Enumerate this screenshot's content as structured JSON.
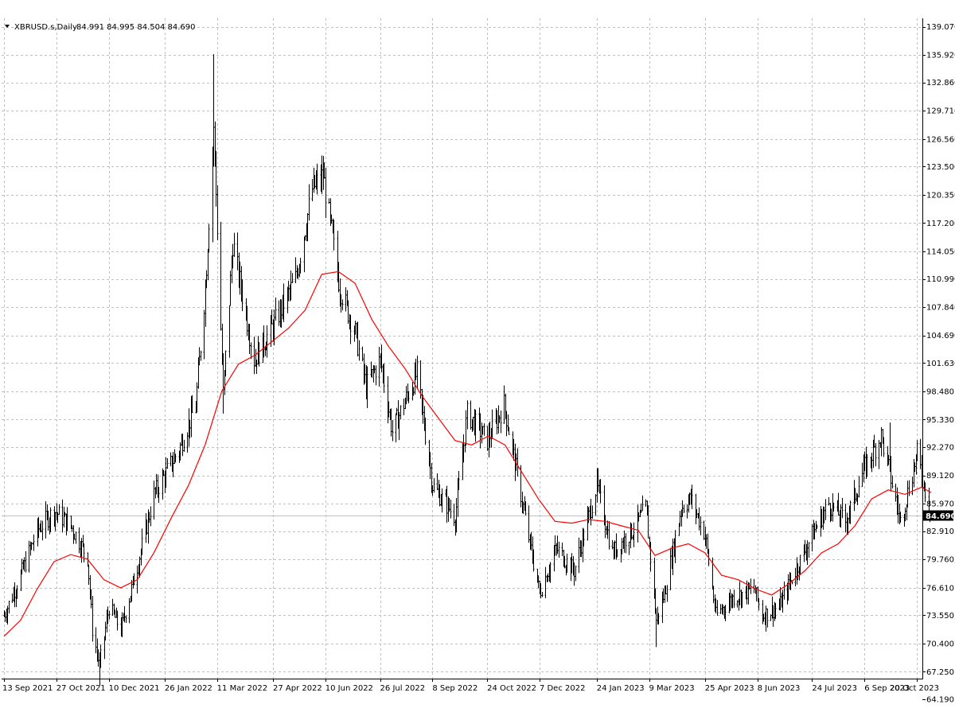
{
  "header": {
    "symbol_label": "XBRUSD.s,Daily",
    "ohlc_label": "84.991 84.995 84.504 84.690",
    "dropdown_icon": "triangle-down-icon"
  },
  "price_tag": {
    "label": "84.690",
    "value": 84.69,
    "background": "#000000",
    "line_color": "#c0c0c0"
  },
  "colors": {
    "bars": "#000000",
    "moving_average": "#ff0000",
    "grid": "#c0c0c0",
    "axis": "#000000",
    "background": "#ffffff"
  },
  "chart_data": {
    "type": "line",
    "title": "",
    "xlabel": "",
    "ylabel": "",
    "grid": true,
    "legend": "none",
    "ylim": [
      64.19,
      139.07
    ],
    "xlim": [
      "2021-09-13",
      "2023-11-01"
    ],
    "y_ticks": [
      139.07,
      135.92,
      132.86,
      129.71,
      126.56,
      123.5,
      120.35,
      117.2,
      114.05,
      110.99,
      107.84,
      104.69,
      101.63,
      98.48,
      95.33,
      92.27,
      89.12,
      85.97,
      82.91,
      79.76,
      76.61,
      73.55,
      70.4,
      67.25,
      64.19
    ],
    "y_tick_labels": [
      "139.070",
      "135.920",
      "132.860",
      "129.710",
      "126.560",
      "123.500",
      "120.350",
      "117.200",
      "114.050",
      "110.990",
      "107.840",
      "104.690",
      "101.630",
      "98.480",
      "95.330",
      "92.270",
      "89.120",
      "85.970",
      "82.910",
      "79.760",
      "76.610",
      "73.550",
      "70.400",
      "67.250",
      "64.190"
    ],
    "x_ticks": [
      "2021-09-13",
      "2021-10-27",
      "2021-12-10",
      "2022-01-26",
      "2022-03-11",
      "2022-04-27",
      "2022-06-10",
      "2022-07-26",
      "2022-09-08",
      "2022-10-24",
      "2022-12-07",
      "2023-01-24",
      "2023-03-09",
      "2023-04-25",
      "2023-06-08",
      "2023-07-24",
      "2023-09-06",
      "2023-10-20"
    ],
    "x_tick_labels": [
      "13 Sep 2021",
      "27 Oct 2021",
      "10 Dec 2021",
      "26 Jan 2022",
      "11 Mar 2022",
      "27 Apr 2022",
      "10 Jun 2022",
      "26 Jul 2022",
      "8 Sep 2022",
      "24 Oct 2022",
      "7 Dec 2022",
      "24 Jan 2023",
      "9 Mar 2023",
      "25 Apr 2023",
      "8 Jun 2023",
      "24 Jul 2023",
      "6 Sep 2023",
      "20 Oct 2023"
    ],
    "series": [
      {
        "type": "ohlc",
        "close_path": [
          [
            "2021-09-13",
            73.5
          ],
          [
            "2021-09-27",
            78.0
          ],
          [
            "2021-10-11",
            83.0
          ],
          [
            "2021-10-25",
            85.2
          ],
          [
            "2021-11-08",
            83.5
          ],
          [
            "2021-11-22",
            80.0
          ],
          [
            "2021-11-26",
            72.0
          ],
          [
            "2021-12-02",
            68.0
          ],
          [
            "2021-12-10",
            74.5
          ],
          [
            "2021-12-20",
            72.0
          ],
          [
            "2022-01-03",
            79.0
          ],
          [
            "2022-01-17",
            87.0
          ],
          [
            "2022-02-07",
            92.0
          ],
          [
            "2022-02-21",
            97.0
          ],
          [
            "2022-03-01",
            110.0
          ],
          [
            "2022-03-08",
            128.0
          ],
          [
            "2022-03-16",
            98.0
          ],
          [
            "2022-03-24",
            115.0
          ],
          [
            "2022-04-11",
            102.0
          ],
          [
            "2022-04-28",
            106.0
          ],
          [
            "2022-05-16",
            111.0
          ],
          [
            "2022-05-30",
            121.0
          ],
          [
            "2022-06-08",
            122.5
          ],
          [
            "2022-06-22",
            110.0
          ],
          [
            "2022-07-05",
            105.0
          ],
          [
            "2022-07-14",
            99.0
          ],
          [
            "2022-07-26",
            102.0
          ],
          [
            "2022-08-05",
            94.0
          ],
          [
            "2022-08-26",
            100.5
          ],
          [
            "2022-09-08",
            88.0
          ],
          [
            "2022-09-27",
            84.5
          ],
          [
            "2022-10-07",
            96.0
          ],
          [
            "2022-10-24",
            93.0
          ],
          [
            "2022-11-07",
            97.0
          ],
          [
            "2022-11-21",
            87.0
          ],
          [
            "2022-12-07",
            76.0
          ],
          [
            "2022-12-21",
            81.0
          ],
          [
            "2023-01-05",
            78.5
          ],
          [
            "2023-01-24",
            88.0
          ],
          [
            "2023-02-06",
            80.5
          ],
          [
            "2023-02-23",
            83.0
          ],
          [
            "2023-03-06",
            85.5
          ],
          [
            "2023-03-15",
            73.0
          ],
          [
            "2023-03-22",
            76.0
          ],
          [
            "2023-04-05",
            85.5
          ],
          [
            "2023-04-13",
            86.5
          ],
          [
            "2023-04-25",
            82.5
          ],
          [
            "2023-05-04",
            73.5
          ],
          [
            "2023-05-18",
            75.5
          ],
          [
            "2023-06-05",
            76.5
          ],
          [
            "2023-06-12",
            73.5
          ],
          [
            "2023-06-26",
            74.5
          ],
          [
            "2023-07-10",
            78.5
          ],
          [
            "2023-07-24",
            82.5
          ],
          [
            "2023-08-07",
            86.0
          ],
          [
            "2023-08-21",
            84.0
          ],
          [
            "2023-09-06",
            90.0
          ],
          [
            "2023-09-20",
            93.5
          ],
          [
            "2023-10-06",
            84.0
          ],
          [
            "2023-10-20",
            91.5
          ],
          [
            "2023-11-01",
            84.69
          ]
        ],
        "extremes": [
          [
            "2021-12-02",
            65.7,
            "low"
          ],
          [
            "2022-03-08",
            136.0,
            "high"
          ],
          [
            "2022-06-08",
            123.0,
            "high"
          ],
          [
            "2022-03-16",
            96.0,
            "low"
          ],
          [
            "2023-03-15",
            70.0,
            "low"
          ],
          [
            "2023-09-27",
            95.0,
            "high"
          ]
        ]
      },
      {
        "type": "line",
        "points": [
          [
            "2021-09-13",
            71.2
          ],
          [
            "2021-09-27",
            73.0
          ],
          [
            "2021-10-11",
            76.5
          ],
          [
            "2021-10-25",
            79.5
          ],
          [
            "2021-11-08",
            80.3
          ],
          [
            "2021-11-22",
            79.8
          ],
          [
            "2021-12-06",
            77.5
          ],
          [
            "2021-12-20",
            76.6
          ],
          [
            "2022-01-03",
            77.5
          ],
          [
            "2022-01-17",
            80.5
          ],
          [
            "2022-02-01",
            84.5
          ],
          [
            "2022-02-15",
            88.0
          ],
          [
            "2022-03-01",
            92.5
          ],
          [
            "2022-03-15",
            98.5
          ],
          [
            "2022-03-29",
            101.5
          ],
          [
            "2022-04-12",
            102.5
          ],
          [
            "2022-04-26",
            104.0
          ],
          [
            "2022-05-10",
            105.5
          ],
          [
            "2022-05-24",
            107.5
          ],
          [
            "2022-06-07",
            111.5
          ],
          [
            "2022-06-21",
            111.8
          ],
          [
            "2022-07-05",
            110.5
          ],
          [
            "2022-07-19",
            106.5
          ],
          [
            "2022-08-02",
            103.5
          ],
          [
            "2022-08-16",
            101.0
          ],
          [
            "2022-08-30",
            98.0
          ],
          [
            "2022-09-13",
            95.5
          ],
          [
            "2022-09-27",
            93.0
          ],
          [
            "2022-10-11",
            92.5
          ],
          [
            "2022-10-25",
            93.5
          ],
          [
            "2022-11-08",
            92.5
          ],
          [
            "2022-11-22",
            89.5
          ],
          [
            "2022-12-06",
            86.5
          ],
          [
            "2022-12-20",
            84.0
          ],
          [
            "2023-01-03",
            83.8
          ],
          [
            "2023-01-17",
            84.2
          ],
          [
            "2023-01-31",
            84.0
          ],
          [
            "2023-02-14",
            83.5
          ],
          [
            "2023-02-28",
            83.0
          ],
          [
            "2023-03-14",
            80.2
          ],
          [
            "2023-03-28",
            81.0
          ],
          [
            "2023-04-11",
            81.5
          ],
          [
            "2023-04-25",
            80.5
          ],
          [
            "2023-05-09",
            78.0
          ],
          [
            "2023-05-23",
            77.5
          ],
          [
            "2023-06-06",
            76.5
          ],
          [
            "2023-06-20",
            75.8
          ],
          [
            "2023-07-04",
            77.0
          ],
          [
            "2023-07-18",
            78.5
          ],
          [
            "2023-08-01",
            80.5
          ],
          [
            "2023-08-15",
            81.5
          ],
          [
            "2023-08-29",
            83.5
          ],
          [
            "2023-09-12",
            86.5
          ],
          [
            "2023-09-26",
            87.5
          ],
          [
            "2023-10-10",
            87.0
          ],
          [
            "2023-10-24",
            87.8
          ],
          [
            "2023-11-01",
            87.2
          ]
        ]
      }
    ]
  }
}
